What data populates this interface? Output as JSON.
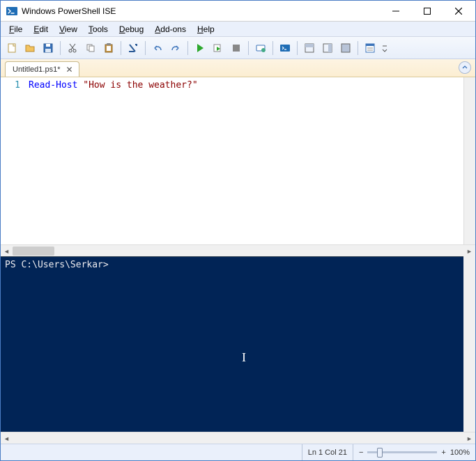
{
  "window": {
    "title": "Windows PowerShell ISE"
  },
  "menu": {
    "file": "File",
    "edit": "Edit",
    "view": "View",
    "tools": "Tools",
    "debug": "Debug",
    "addons": "Add-ons",
    "help": "Help"
  },
  "tab": {
    "label": "Untitled1.ps1*"
  },
  "editor": {
    "line_number": "1",
    "code_cmd": "Read-Host",
    "code_str": "\"How is the weather?\""
  },
  "console": {
    "prompt": "PS C:\\Users\\Serkar> "
  },
  "status": {
    "position": "Ln 1  Col 21",
    "zoom": "100%"
  },
  "colors": {
    "console_bg": "#012456",
    "keyword": "#0000ff",
    "string": "#8b0000"
  }
}
